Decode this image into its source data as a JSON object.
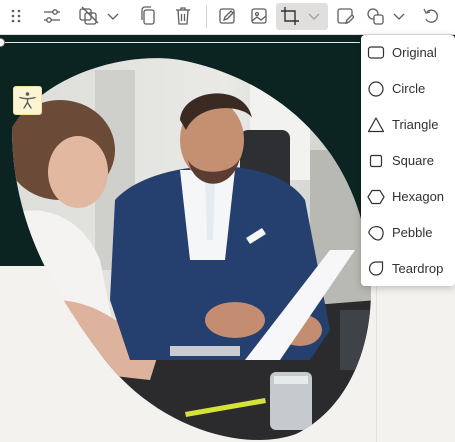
{
  "toolbar": {
    "icons": [
      "drag-handle-icon",
      "adjust-sliders-icon",
      "image-filters-icon",
      "chevron-down-icon",
      "copy-icon",
      "delete-icon",
      "edit-image-icon",
      "replace-image-icon",
      "crop-icon",
      "chevron-down-icon",
      "alt-text-icon",
      "shape-icon",
      "chevron-down-icon",
      "undo-icon"
    ],
    "active": "crop"
  },
  "shape_menu": {
    "items": [
      {
        "label": "Original",
        "icon": "rounded-rectangle-icon"
      },
      {
        "label": "Circle",
        "icon": "circle-icon"
      },
      {
        "label": "Triangle",
        "icon": "triangle-icon"
      },
      {
        "label": "Square",
        "icon": "square-icon"
      },
      {
        "label": "Hexagon",
        "icon": "hexagon-icon"
      },
      {
        "label": "Pebble",
        "icon": "pebble-icon"
      },
      {
        "label": "Teardrop",
        "icon": "teardrop-icon"
      }
    ]
  },
  "image": {
    "shape": "pebble",
    "badge_icon": "accessibility-icon"
  },
  "colors": {
    "dark_background": "#0c2421",
    "canvas": "#f3f2ee",
    "badge": "#fdf4d3",
    "active_button": "#e1dfdd"
  }
}
